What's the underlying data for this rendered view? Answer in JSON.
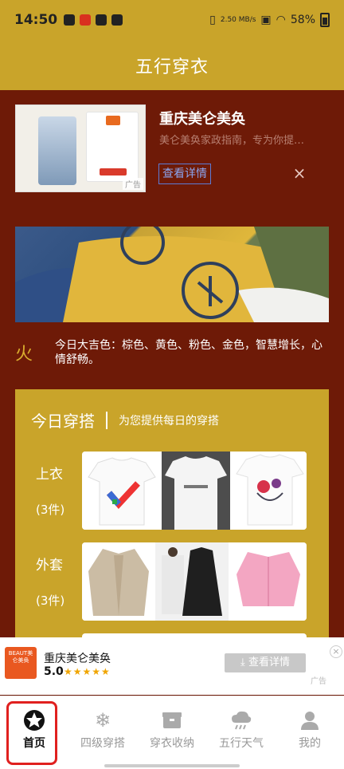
{
  "status": {
    "time": "14:50",
    "net_speed": "2.50 MB/s",
    "battery": "58%"
  },
  "header": {
    "title": "五行穿衣"
  },
  "top_ad": {
    "headline": "重庆美仑美奂",
    "description": "美仑美奂家政指南，专为你提…",
    "cta": "查看详情",
    "tag": "广告",
    "close": "×"
  },
  "element": {
    "char": "火",
    "text": "今日大吉色：棕色、黄色、粉色、金色，智慧增长，心情舒畅。"
  },
  "outfit": {
    "title": "今日穿搭",
    "subtitle": "为您提供每日的穿搭",
    "rows": [
      {
        "label": "上衣",
        "count": "(3件)"
      },
      {
        "label": "外套",
        "count": "(3件)"
      }
    ]
  },
  "bottom_ad": {
    "logo_text": "BEAUT美仑美奂",
    "name": "重庆美仑美奂",
    "rating": "5.0",
    "stars": "★★★★★",
    "cta": "查看详情",
    "tag": "广告",
    "close": "×"
  },
  "tabs": [
    {
      "label": "首页",
      "icon": "star-badge-icon",
      "active": true
    },
    {
      "label": "四级穿搭",
      "icon": "snowflake-icon",
      "active": false
    },
    {
      "label": "穿衣收纳",
      "icon": "box-icon",
      "active": false
    },
    {
      "label": "五行天气",
      "icon": "cloud-rain-icon",
      "active": false
    },
    {
      "label": "我的",
      "icon": "user-icon",
      "active": false
    }
  ],
  "colors": {
    "header_gold": "#c9a42a",
    "background_maroon": "#6e1a07",
    "accent_red": "#e0201f"
  }
}
